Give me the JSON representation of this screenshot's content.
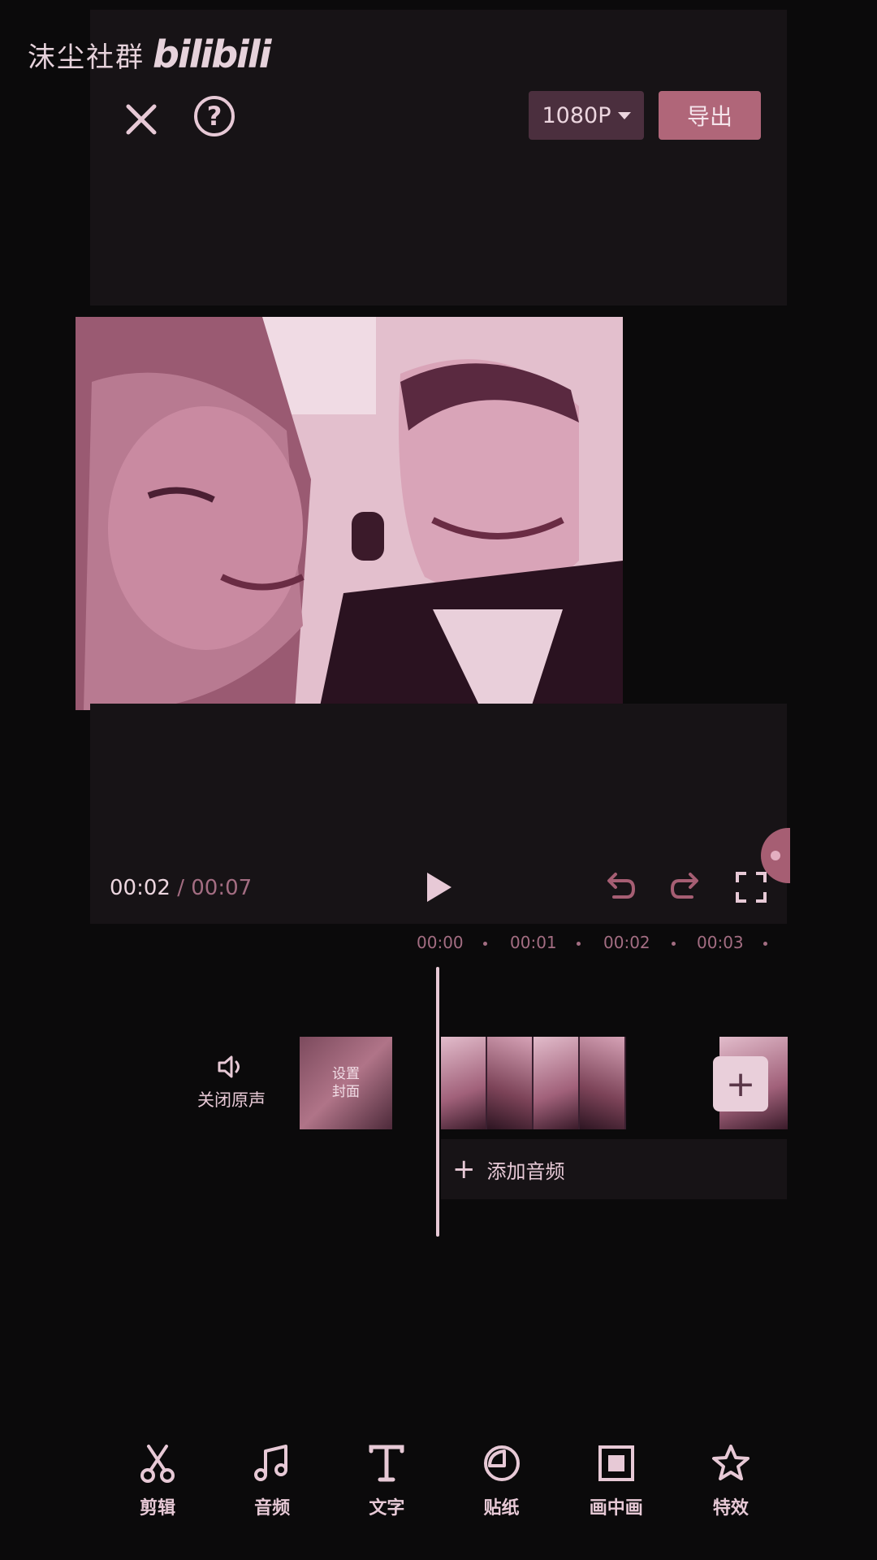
{
  "watermark": {
    "text": "沫尘社群",
    "brand": "bilibili"
  },
  "header": {
    "resolution_label": "1080P",
    "export_label": "导出"
  },
  "player": {
    "current_time": "00:02",
    "separator": "/",
    "total_time": "00:07"
  },
  "timeline": {
    "ruler": [
      "00:00",
      "00:01",
      "00:02",
      "00:03"
    ],
    "mute_label": "关闭原声",
    "cover_label_line1": "设置",
    "cover_label_line2": "封面",
    "add_audio_label": "添加音频"
  },
  "toolbar": {
    "items": [
      {
        "label": "剪辑",
        "icon": "scissors-icon"
      },
      {
        "label": "音频",
        "icon": "music-note-icon"
      },
      {
        "label": "文字",
        "icon": "text-icon"
      },
      {
        "label": "贴纸",
        "icon": "sticker-icon"
      },
      {
        "label": "画中画",
        "icon": "picture-in-picture-icon"
      },
      {
        "label": "特效",
        "icon": "effects-star-icon"
      }
    ]
  },
  "colors": {
    "accent": "#b06679",
    "text": "#e7c9d6",
    "panel": "#171316",
    "background": "#0b0a0b"
  }
}
